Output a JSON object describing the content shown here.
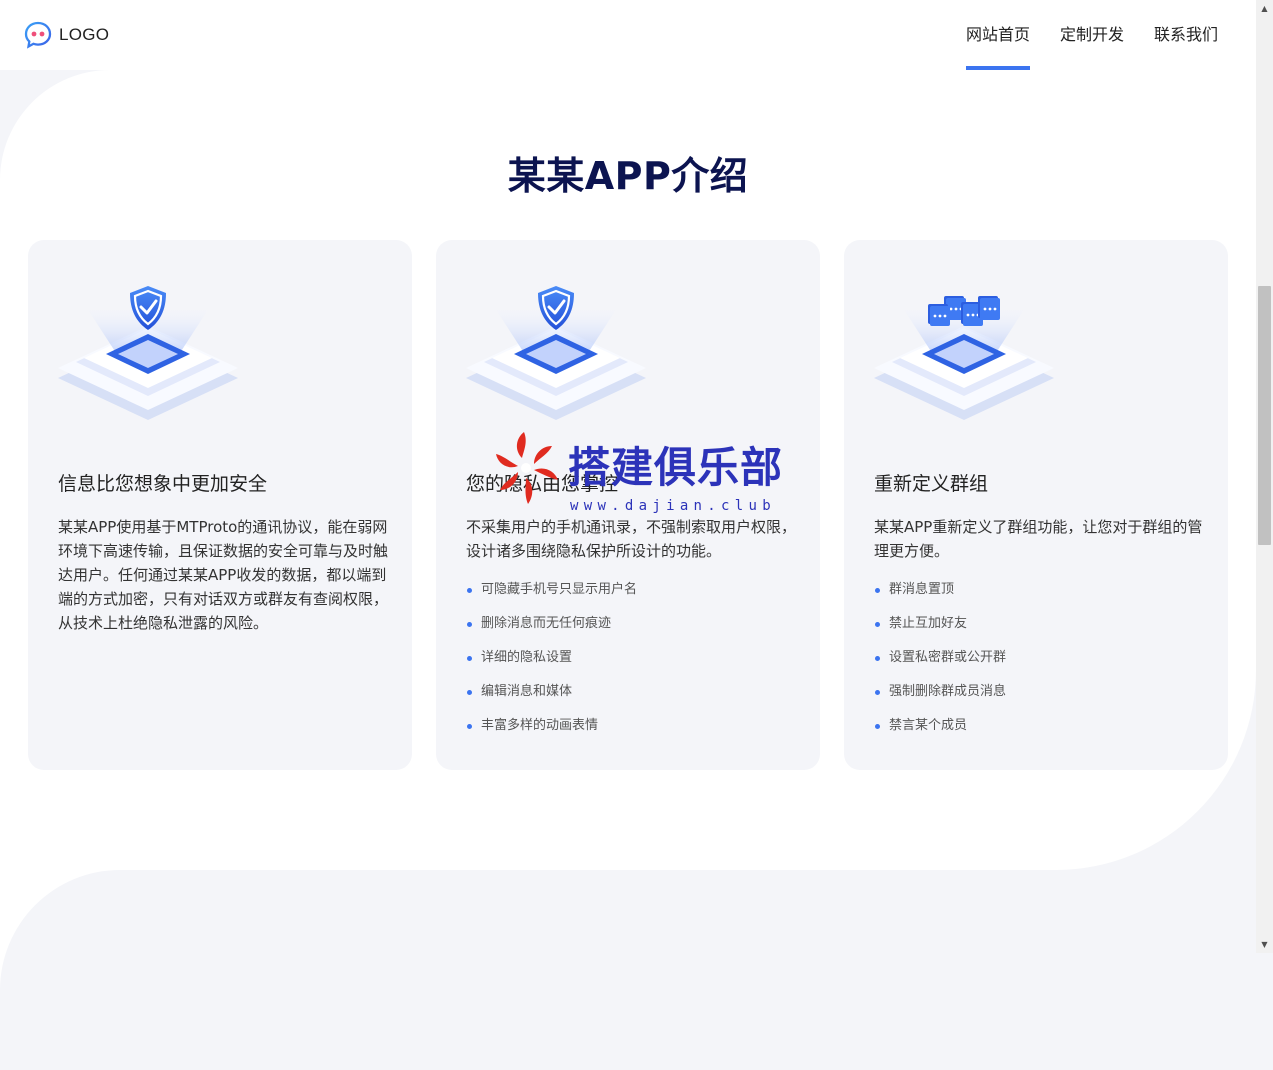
{
  "header": {
    "logo_text": "LOGO",
    "nav": [
      {
        "label": "网站首页",
        "active": true
      },
      {
        "label": "定制开发",
        "active": false
      },
      {
        "label": "联系我们",
        "active": false
      }
    ]
  },
  "section": {
    "title": "某某APP介绍"
  },
  "cards": [
    {
      "icon": "shield-check-icon",
      "title": "信息比您想象中更加安全",
      "desc": "某某APP使用基于MTProto的通讯协议，能在弱网环境下高速传输，且保证数据的安全可靠与及时触达用户。任何通过某某APP收发的数据，都以端到端的方式加密，只有对话双方或群友有查阅权限，从技术上杜绝隐私泄露的风险。",
      "items": []
    },
    {
      "icon": "shield-check-icon",
      "title": "您的隐私由您掌控",
      "desc": "不采集用户的手机通讯录，不强制索取用户权限，设计诸多围绕隐私保护所设计的功能。",
      "items": [
        "可隐藏手机号只显示用户名",
        "删除消息而无任何痕迹",
        "详细的隐私设置",
        "编辑消息和媒体",
        "丰富多样的动画表情"
      ]
    },
    {
      "icon": "chat-bubbles-icon",
      "title": "重新定义群组",
      "desc": "某某APP重新定义了群组功能，让您对于群组的管理更方便。",
      "items": [
        "群消息置顶",
        "禁止互加好友",
        "设置私密群或公开群",
        "强制删除群成员消息",
        "禁言某个成员"
      ]
    }
  ],
  "watermark": {
    "text": "搭建俱乐部",
    "url": "www.dajian.club"
  },
  "colors": {
    "accent": "#3b74f0",
    "title": "#0c1450",
    "card_bg": "#f4f5f9",
    "watermark": "#2c33b9"
  }
}
